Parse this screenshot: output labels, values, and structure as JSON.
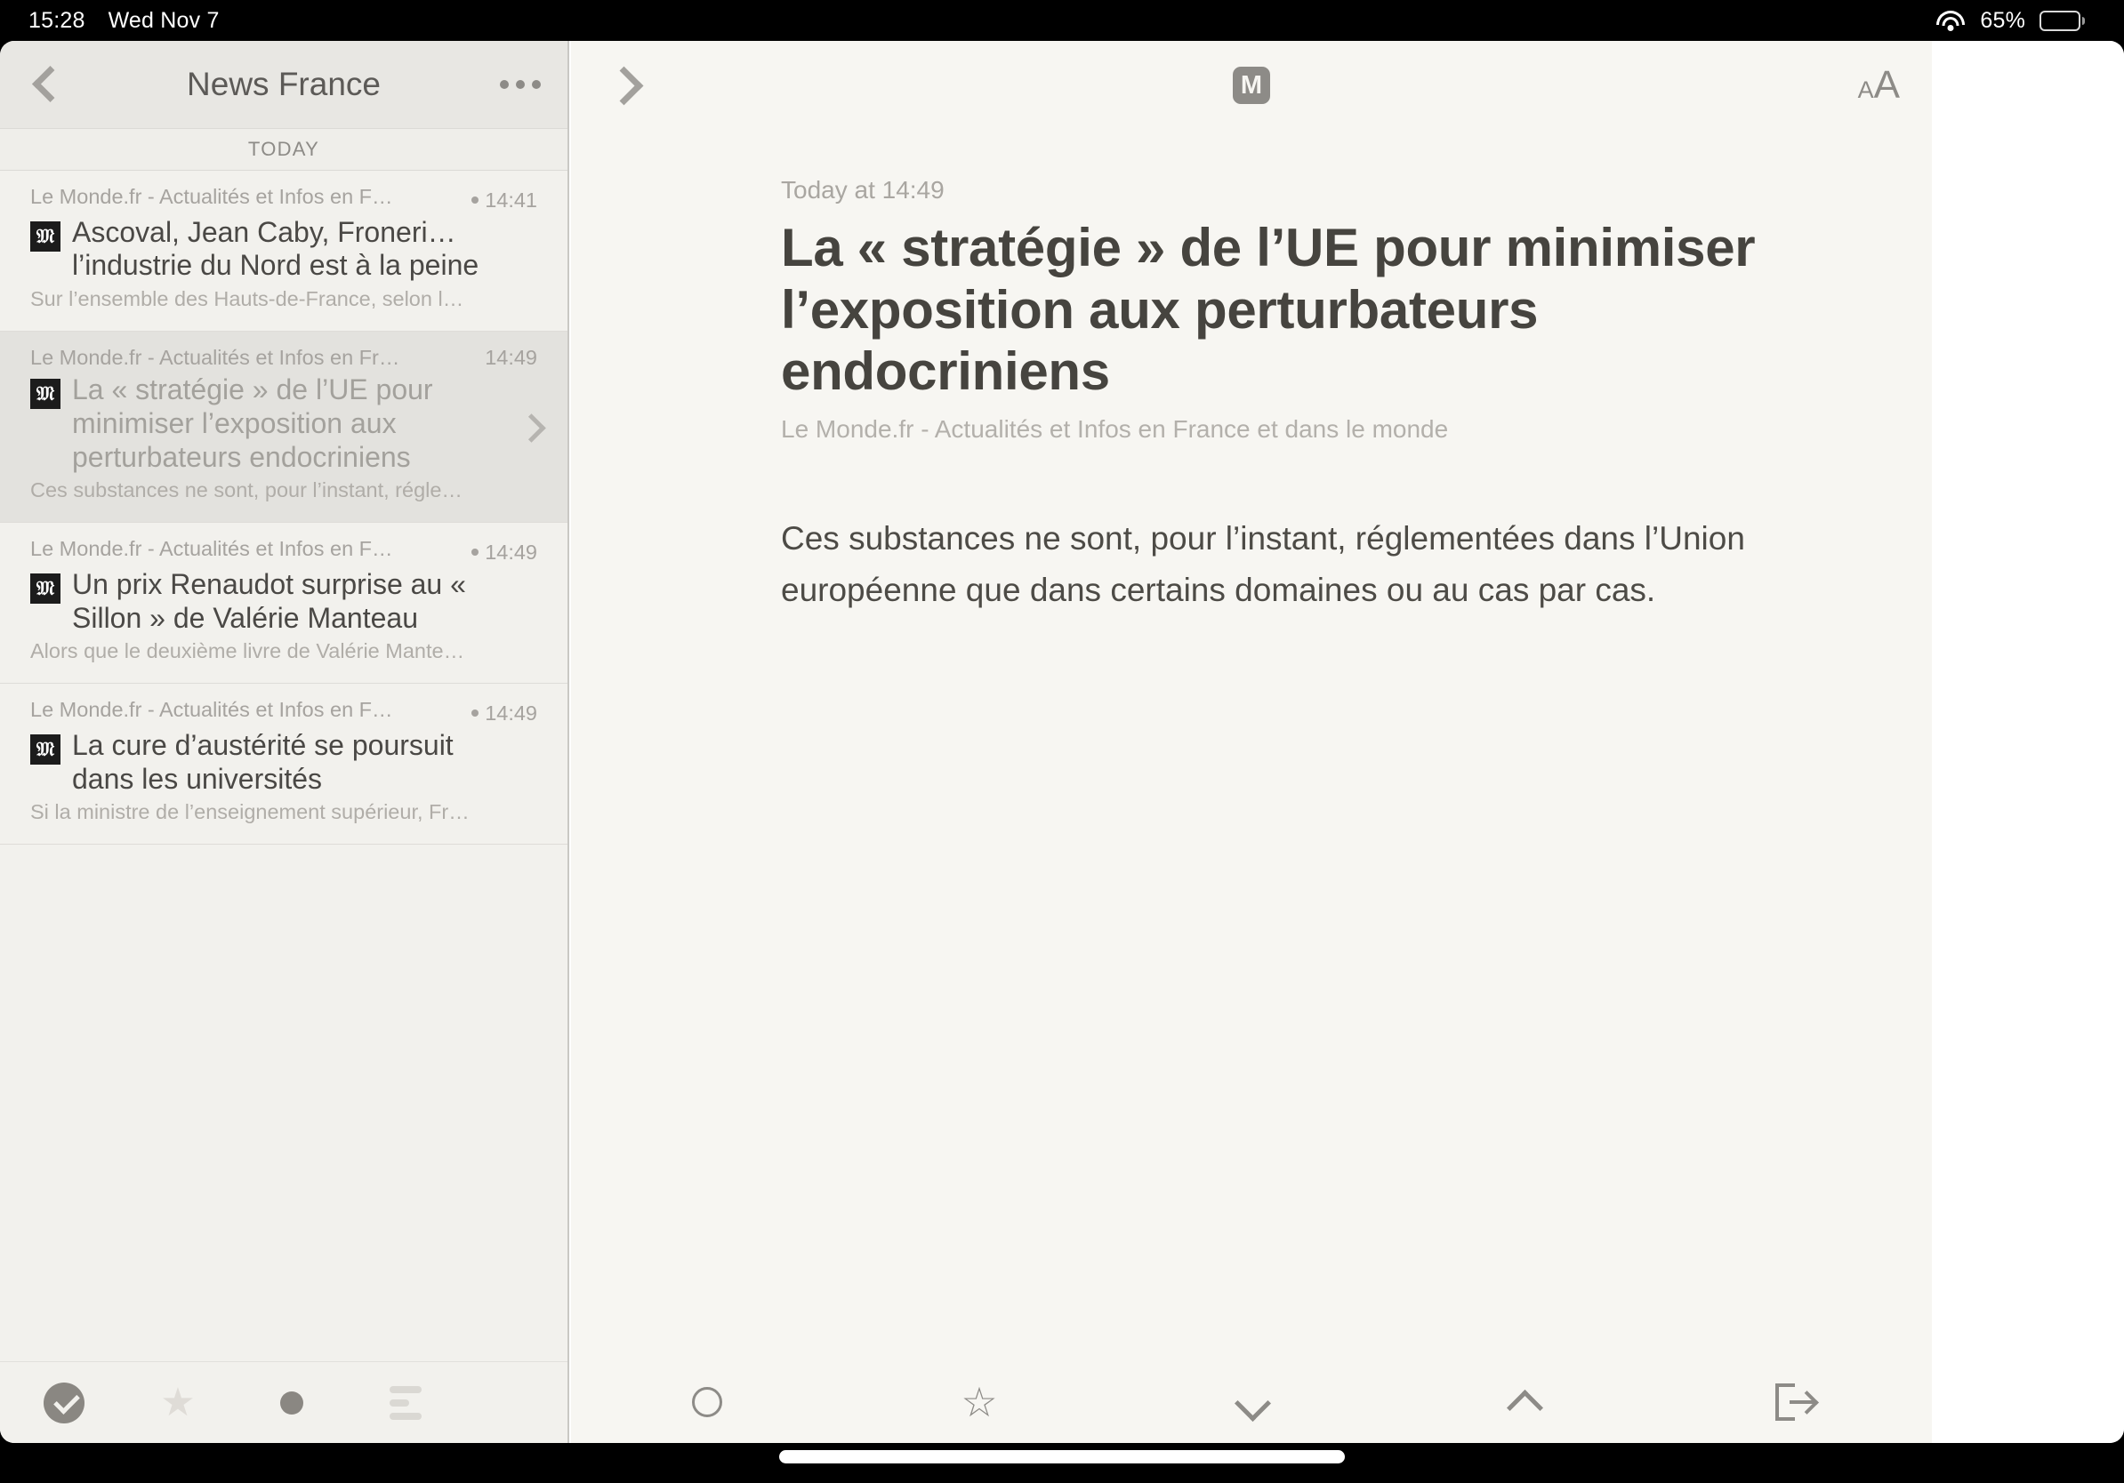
{
  "statusbar": {
    "time": "15:28",
    "date": "Wed Nov 7",
    "battery_percent": "65%",
    "wifi_icon": "wifi-icon",
    "battery_icon": "battery-icon"
  },
  "sidebar": {
    "header": {
      "back_icon": "chevron-left-icon",
      "title": "News France",
      "more_icon": "ellipsis-icon"
    },
    "section_label": "TODAY",
    "articles": [
      {
        "source": "Le Monde.fr - Actualités et Infos en F…",
        "time": "14:41",
        "unread": true,
        "favicon": "le-monde-favicon",
        "title": "Ascoval, Jean Caby, Froneri… l’industrie du Nord est à la peine",
        "snippet": "Sur l’ensemble des Hauts-de-France, selon l…",
        "selected": false
      },
      {
        "source": "Le Monde.fr - Actualités et Infos en Fr…",
        "time": "14:49",
        "unread": false,
        "favicon": "le-monde-favicon",
        "title": "La « stratégie » de l’UE pour minimiser l’exposition aux perturbateurs endocriniens",
        "snippet": "Ces substances ne sont, pour l’instant, régle…",
        "selected": true
      },
      {
        "source": "Le Monde.fr - Actualités et Infos en F…",
        "time": "14:49",
        "unread": true,
        "favicon": "le-monde-favicon",
        "title": "Un prix Renaudot surprise au « Sillon » de Valérie Manteau",
        "snippet": "Alors que le deuxième livre de Valérie Mante…",
        "selected": false
      },
      {
        "source": "Le Monde.fr - Actualités et Infos en F…",
        "time": "14:49",
        "unread": true,
        "favicon": "le-monde-favicon",
        "title": "La cure d’austérité se poursuit dans les universités",
        "snippet": "Si la ministre de l’enseignement supérieur, Fr…",
        "selected": false
      }
    ],
    "toolbar": [
      {
        "icon": "mark-read-check-icon",
        "label": "Mark all read",
        "active": true
      },
      {
        "icon": "star-filled-icon",
        "label": "Starred",
        "active": false
      },
      {
        "icon": "unread-dot-icon",
        "label": "Unread",
        "active": false
      },
      {
        "icon": "list-lines-icon",
        "label": "View options",
        "active": false
      }
    ]
  },
  "reader": {
    "header": {
      "forward_icon": "chevron-right-icon",
      "site_logo": "le-monde-m-logo",
      "site_logo_letter": "M",
      "text_size_icon": "text-size-aa-icon",
      "text_size_small": "A",
      "text_size_large": "A"
    },
    "article": {
      "date": "Today at 14:49",
      "title": "La « stratégie » de l’UE pour minimiser l’exposition aux perturbateurs endocriniens",
      "source": "Le Monde.fr - Actualités et Infos en France et dans le monde",
      "body": "Ces substances ne sont, pour l’instant, réglementées dans l’Union européenne que dans certains domaines ou au cas par cas."
    },
    "toolbar": [
      {
        "icon": "mark-unread-circle-icon",
        "label": "Toggle read"
      },
      {
        "icon": "star-outline-icon",
        "label": "Star"
      },
      {
        "icon": "chevron-down-icon",
        "label": "Next article"
      },
      {
        "icon": "chevron-up-icon",
        "label": "Previous article"
      },
      {
        "icon": "share-export-icon",
        "label": "Share"
      }
    ]
  },
  "colors": {
    "sidebar_bg": "#e8e7e3",
    "list_bg": "#f2f1ed",
    "selected_row": "#e3e2de",
    "reader_bg": "#f7f6f2",
    "text_primary": "#46443f",
    "text_muted": "#a6a39f",
    "icon_gray": "#8d8b87"
  },
  "home_indicator": "home-indicator-bar"
}
